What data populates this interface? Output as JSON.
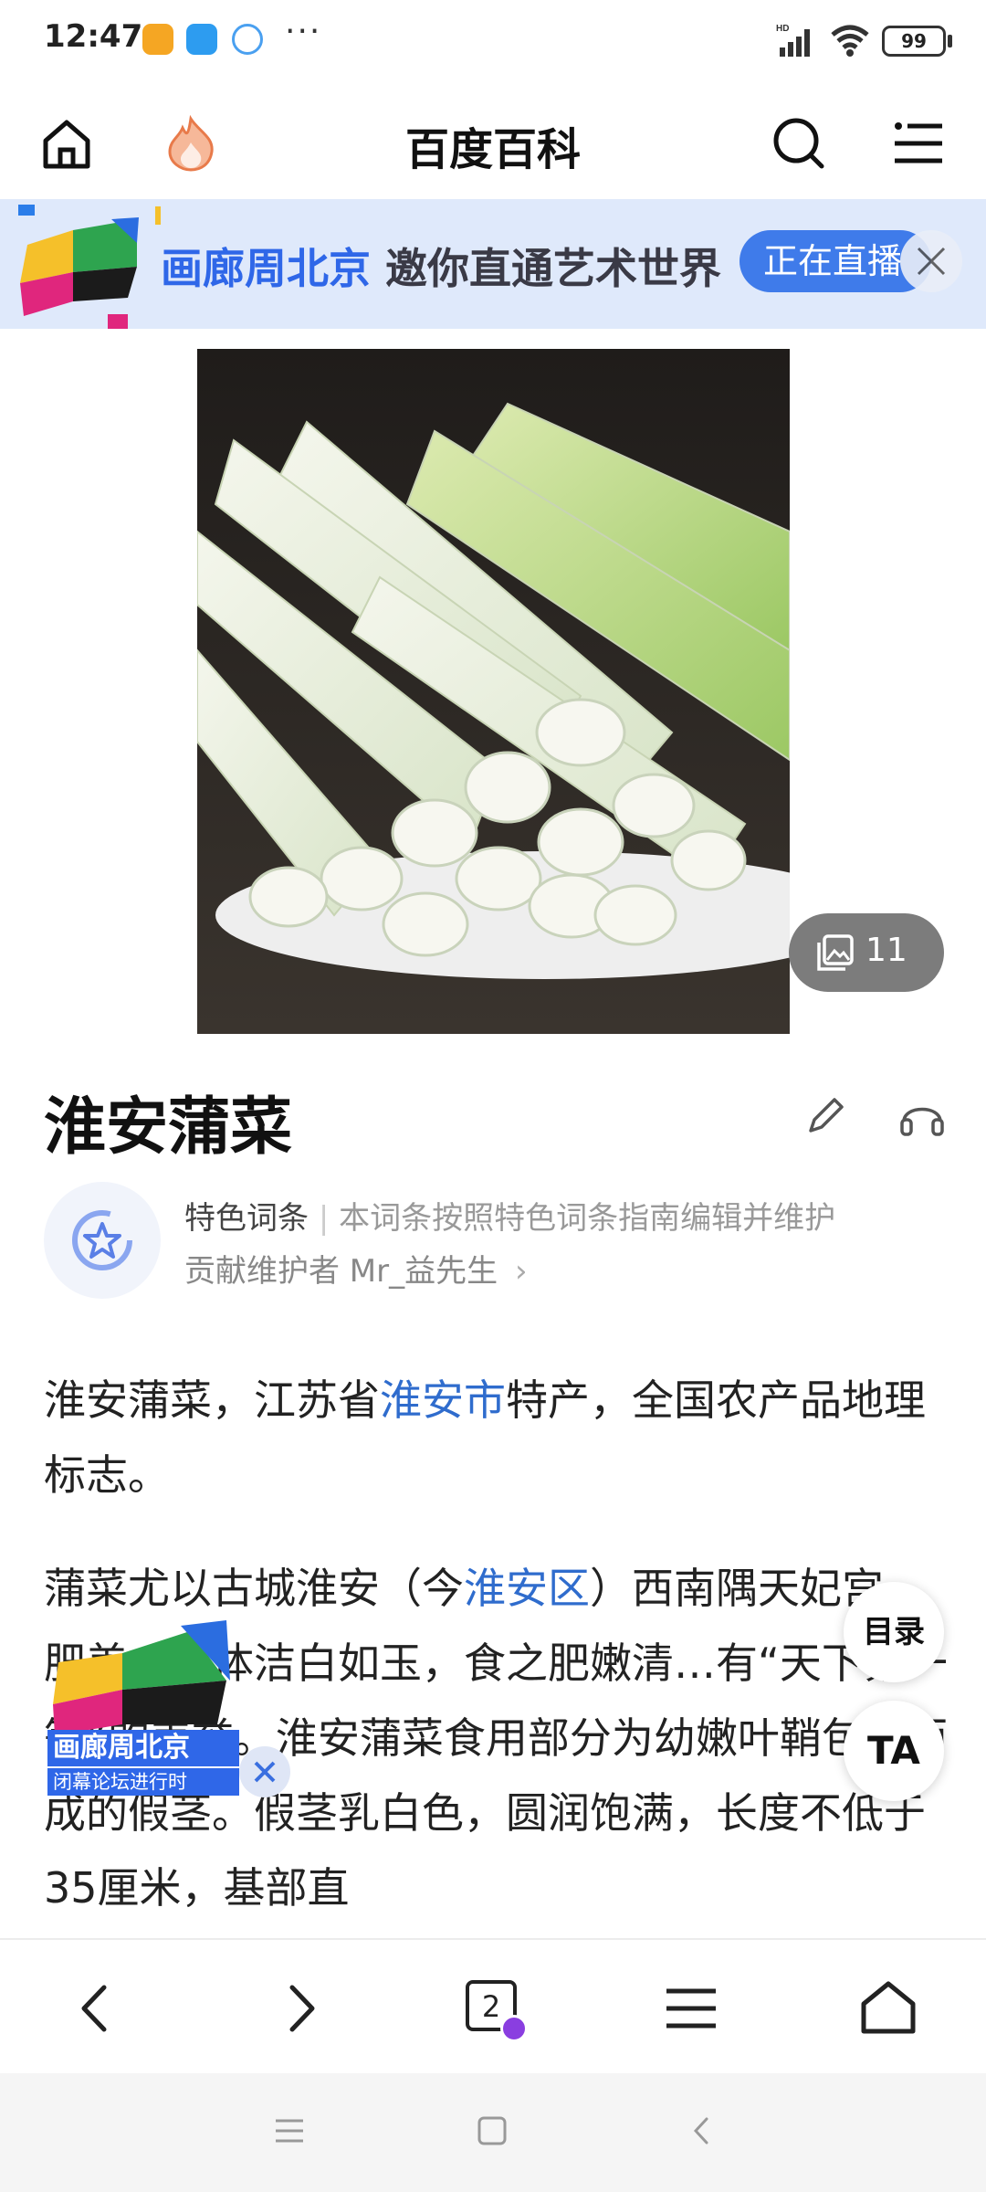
{
  "status_bar": {
    "time": "12:47",
    "dots": "···",
    "network_label": "HD",
    "battery": "99"
  },
  "header": {
    "title": "百度百科"
  },
  "ad_banner": {
    "brand": "画廊周北京",
    "slogan": "邀你直通艺术世界",
    "live_label": "正在直播"
  },
  "hero": {
    "gallery_count": "11"
  },
  "article": {
    "title": "淮安蒲菜",
    "feature_tag": "特色词条",
    "feature_separator": "|",
    "feature_desc": "本词条按照特色词条指南编辑并维护",
    "contributor": "贡献维护者 Mr_益先生",
    "contributor_arrow": "›",
    "p1_a": "淮安蒲菜，江苏省",
    "p1_link": "淮安市",
    "p1_b": "特产，全国农产品地理标志。",
    "p2_a": "蒲菜尤以古城淮安（今",
    "p2_link": "淮安区",
    "p2_b": "）西南隅天妃宫…肥美，菜体洁白如玉，食之肥嫩清…有“天下第一笋”的美誉。淮安蒲菜食用部分为幼嫩叶鞘包裹而成的假茎。假茎乳白色，圆润饱满，长度不低于35厘米，基部直"
  },
  "floating": {
    "toc_label": "目录",
    "ta_label": "TA"
  },
  "mini_banner": {
    "brand": "画廊周北京",
    "sub": "闭幕论坛进行时"
  },
  "bottom_nav": {
    "tab_count": "2"
  },
  "colors": {
    "link": "#2f6ccd",
    "banner_bg": "#dfe9fb",
    "live_btn": "#3f7bea"
  }
}
